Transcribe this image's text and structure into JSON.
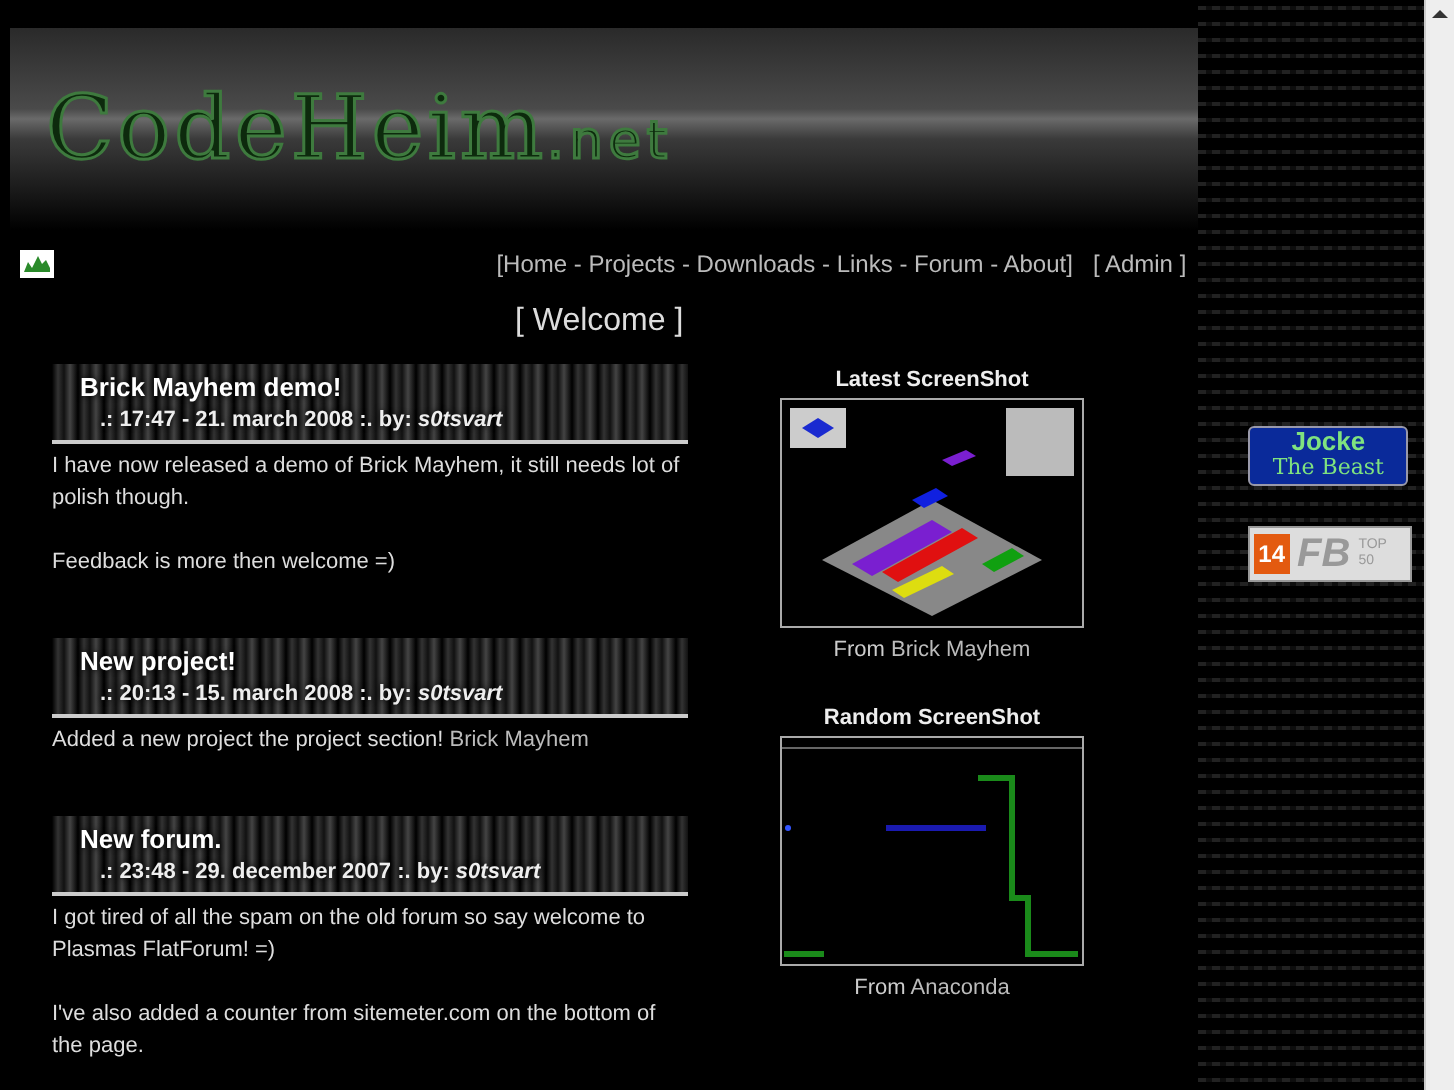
{
  "logo": {
    "name": "CodeHeim",
    "suffix": ".net"
  },
  "nav": {
    "open": "[",
    "separator": "-",
    "close": "]",
    "admin_open": "[",
    "admin_close": "]",
    "main": [
      {
        "label": "Home",
        "selected": false
      },
      {
        "label": "Projects",
        "selected": false
      },
      {
        "label": "Downloads",
        "selected": false
      },
      {
        "label": "Links",
        "selected": false
      },
      {
        "label": "Forum",
        "selected": false
      },
      {
        "label": "About",
        "selected": false
      }
    ],
    "admin": {
      "label": "Admin"
    }
  },
  "page_title": "[ Welcome ]",
  "news": [
    {
      "title": "Brick Mayhem demo!",
      "meta": ".: 17:47 - 21. march 2008 :. by: *s0tsvart*",
      "paragraphs": [
        [
          {
            "text": "I have now released a demo of Brick Mayhem, it still needs lot of polish though."
          }
        ],
        [
          {
            "text": "Feedback is more then welcome =)"
          }
        ]
      ]
    },
    {
      "title": "New project!",
      "meta": ".: 20:13 - 15. march 2008 :. by: *s0tsvart*",
      "paragraphs": [
        [
          {
            "kind": "text",
            "text": "Added a new project the project section! "
          },
          {
            "kind": "link",
            "text": "Brick Mayhem"
          }
        ]
      ]
    },
    {
      "title": "New forum.",
      "meta": ".: 23:48 - 29. december 2007 :. by: *s0tsvart*",
      "paragraphs": [
        [
          {
            "text": "I got tired of all the spam on the old forum so say welcome to Plasmas FlatForum! =)"
          }
        ],
        [
          {
            "text": "I've also added a counter from sitemeter.com on the bottom of the page."
          }
        ]
      ]
    }
  ],
  "screenshots": [
    {
      "kind": "iso",
      "heading": "Latest ScreenShot",
      "from": "From",
      "game": "Brick Mayhem"
    },
    {
      "kind": "snake",
      "heading": "Random ScreenShot",
      "from": "From",
      "game": "Anaconda"
    }
  ],
  "badges": [
    {
      "kind": "jocke",
      "line1": "Jocke",
      "line2": "The Beast"
    },
    {
      "kind": "top50",
      "rank": "14",
      "name": "FB",
      "tag": "TOP 50"
    }
  ]
}
